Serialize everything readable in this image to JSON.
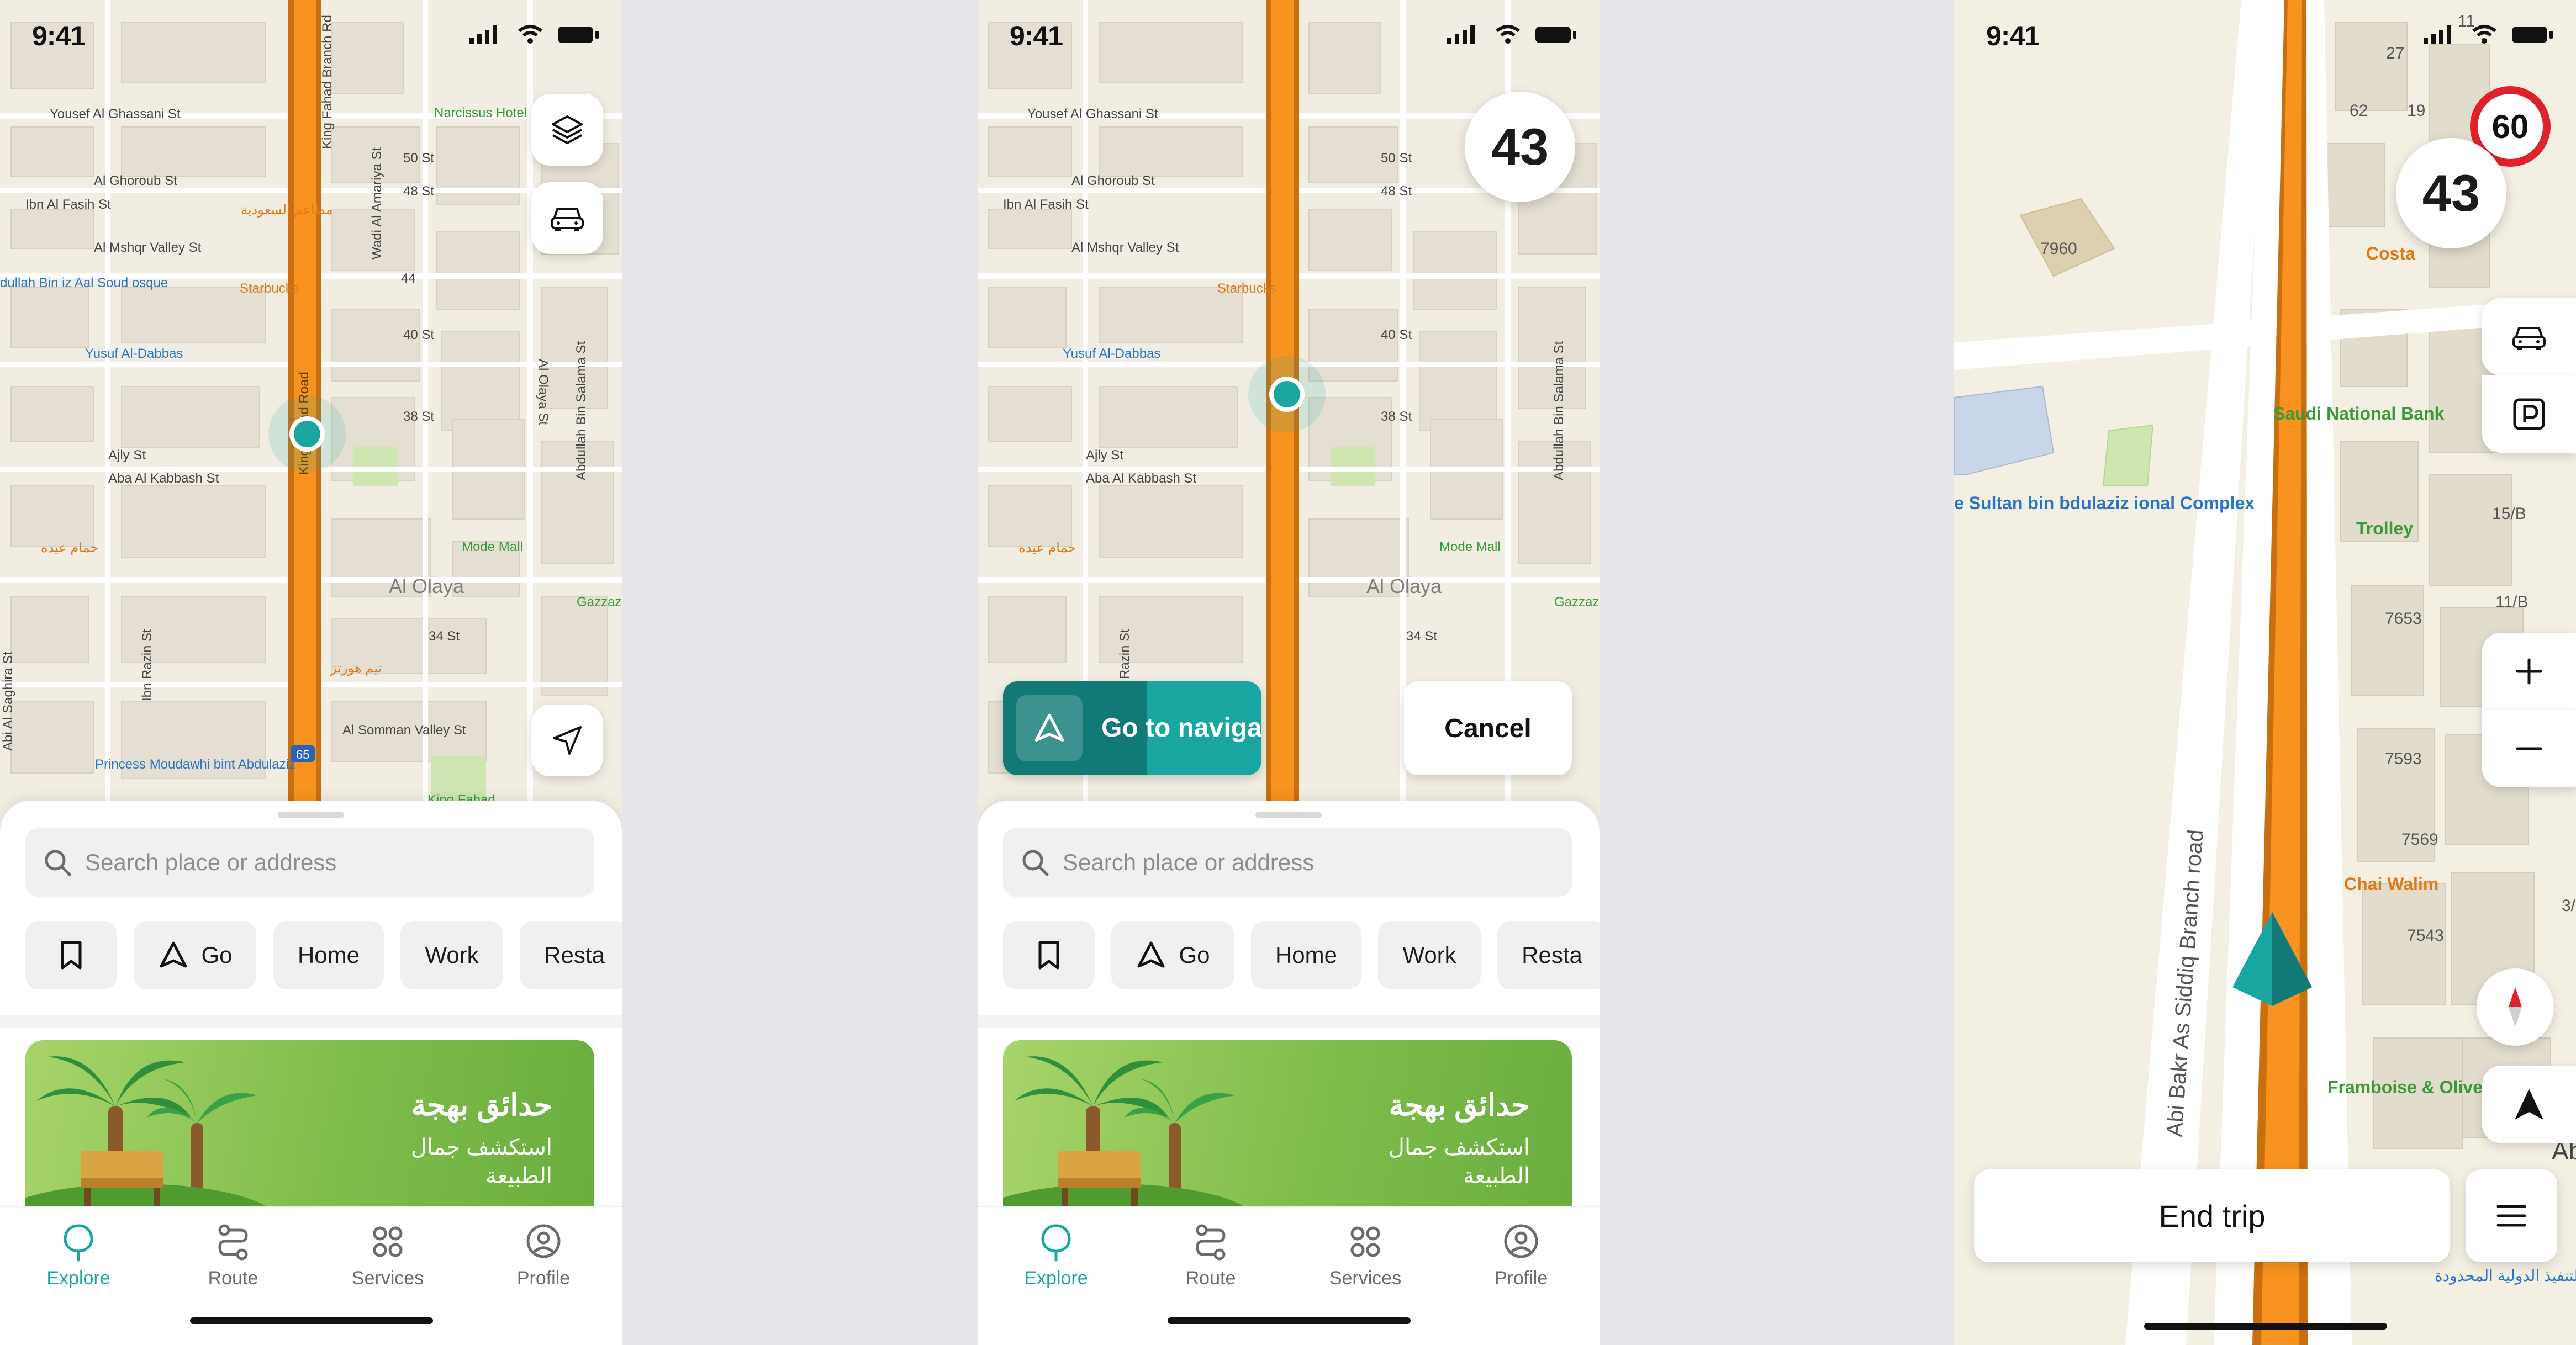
{
  "status": {
    "time": "9:41"
  },
  "explore_screen": {
    "search_placeholder": "Search place or address",
    "chips": {
      "go": "Go",
      "home": "Home",
      "work": "Work",
      "restaurants": "Resta"
    },
    "promo": {
      "title": "حدائق بهجة",
      "subtitle": "استكشف جمال الطبيعة"
    },
    "tabs": {
      "explore": "Explore",
      "route": "Route",
      "services": "Services",
      "profile": "Profile"
    },
    "map_labels": {
      "yousef": "Yousef Al Ghassani St",
      "ghoroub": "Al Ghoroub St",
      "fasih": "Ibn Al Fasih St",
      "mshqr": "Al Mshqr Valley St",
      "starbucks": "Starbucks",
      "yusuf_dabbas": "Yusuf Al-Dabbas",
      "ajly": "Ajly St",
      "kabbash": "Aba Al Kabbash St",
      "mode_mall": "Mode Mall",
      "al_olaya": "Al Olaya",
      "gazzaz": "Gazzaz",
      "somman": "Al Somman Valley St",
      "princess": "Princess Moudawhi bint Abdulaziz",
      "king_fahad": "King Fahad Road",
      "king_fahad_branch": "King Fahad Branch Rd",
      "narcissus": "Narcissus Hotel Riyadh",
      "st50": "50 St",
      "st48": "48 St",
      "st44": "44",
      "st40": "40 St",
      "st38": "38 St",
      "st34": "34 St",
      "wadi_amariya": "Wadi Al Amariya St",
      "olaya_st": "Al Olaya St",
      "abdullah_salama": "Abdullah Bin Salama St",
      "ibn_razin": "Ibn Razin St",
      "saghira": "Abi Al Saghira St",
      "abdullah_bin_mosque": "dullah Bin iz Aal Soud osque",
      "hamam": "حمام عيده",
      "matam": "مطاعم السعودية",
      "tim_hortons": "تيم هورتز",
      "highway": "65",
      "king_fahad_short": "King Fahad"
    }
  },
  "navigator_prompt": {
    "speed": "43",
    "go_to_navigator": "Go to navigator",
    "cancel": "Cancel"
  },
  "drive_screen": {
    "speed": "43",
    "speed_limit": "60",
    "end_trip": "End trip",
    "map_labels": {
      "costa": "Costa",
      "snb": "Saudi National Bank",
      "trolley": "Trolley",
      "chai_walim": "Chai Walim",
      "framboise": "Framboise & Olive",
      "complex": "e Sultan bin bdulaziz ional Complex",
      "road": "Abi Bakr As Siddiq Branch road",
      "b7960": "7960",
      "b7653": "7653",
      "b7593": "7593",
      "b7569": "7569",
      "b7543": "7543",
      "n27": "27",
      "n11": "11",
      "n62": "62",
      "n19": "19",
      "n15b": "15/B",
      "n11b": "11/B",
      "n3": "3/",
      "abi": "Abi",
      "arabic_company": "شركة التنفيذ الدولية المحدودة"
    }
  },
  "colors": {
    "accent": "#1aa6a0",
    "accent_dark": "#127a76",
    "route": "#f7931e",
    "limit_ring": "#e0202a",
    "map_bg": "#f1ede2"
  }
}
